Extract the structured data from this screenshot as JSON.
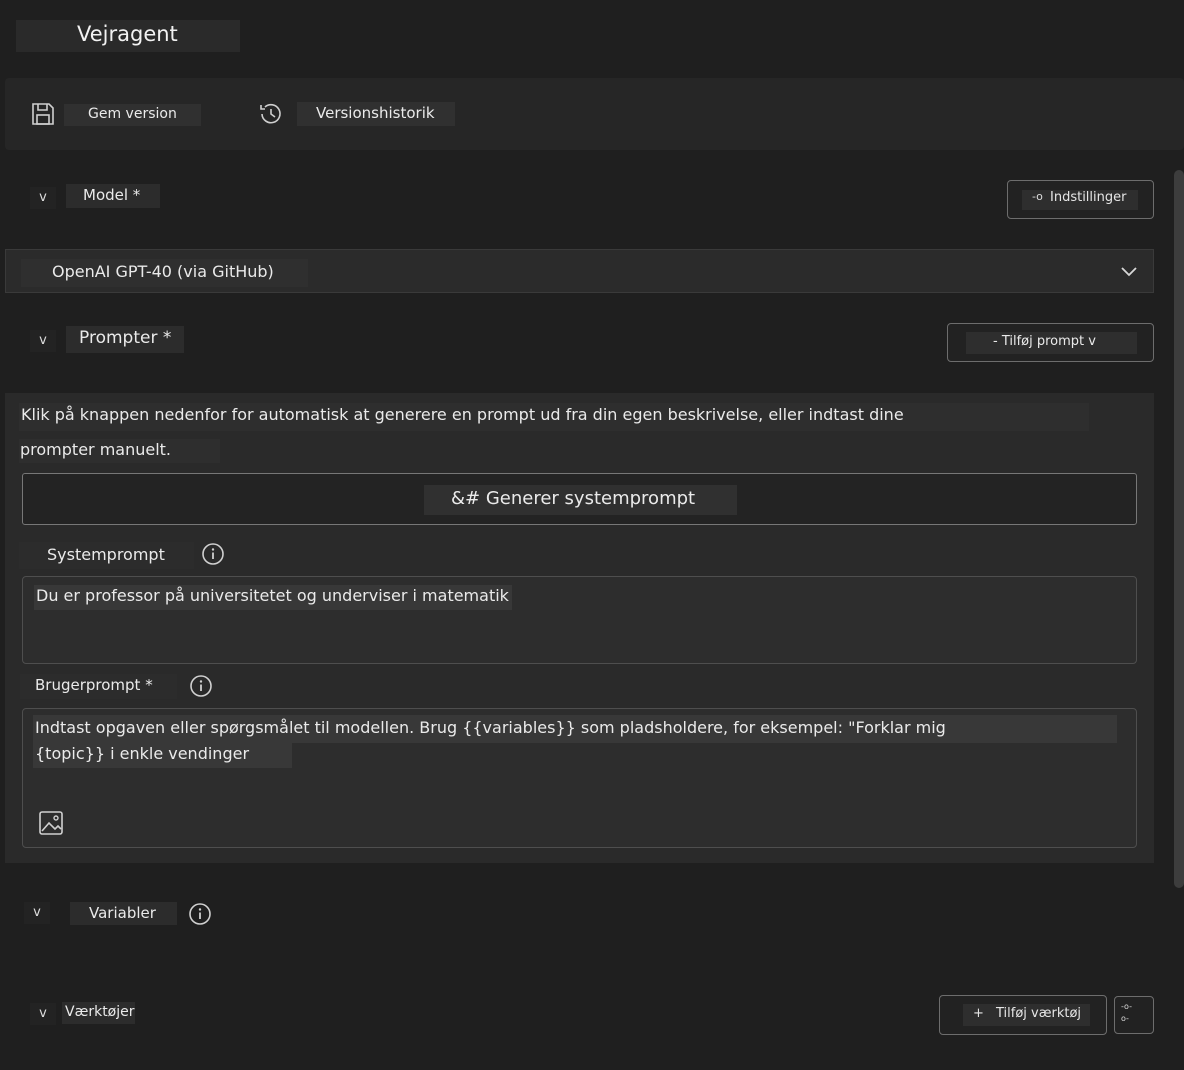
{
  "app": {
    "title": "Vejragent"
  },
  "toolbar": {
    "save_label": "Gem version",
    "history_label": "Versionshistorik",
    "save_icon": "save-icon",
    "history_icon": "history-icon"
  },
  "model_section": {
    "chevron": "v",
    "label": "Model *",
    "settings_label": "Indstillinger",
    "settings_icon_text": "-o",
    "selected_model": "OpenAI GPT-40 (via GitHub)"
  },
  "prompts_section": {
    "chevron": "v",
    "label": "Prompter *",
    "add_prompt_label": "- Tilføj prompt v",
    "instruction_line1": "Klik på knappen nedenfor for automatisk at generere en prompt ud fra din egen beskrivelse, eller indtast dine",
    "instruction_line2": "prompter manuelt.",
    "generate_label": "&# Generer systemprompt",
    "system_prompt_label": "Systemprompt",
    "system_prompt_value": "Du er professor på universitetet og underviser i matematik",
    "user_prompt_label": "Brugerprompt *",
    "user_prompt_line1": "Indtast opgaven eller spørgsmålet til modellen. Brug {{variables}} som pladsholdere, for eksempel: \"Forklar mig",
    "user_prompt_line2": "{topic}} i enkle vendinger"
  },
  "variables_section": {
    "chevron": "v",
    "label": "Variabler"
  },
  "tools_section": {
    "chevron": "v",
    "label": "Værktøjer",
    "add_tool_plus": "+",
    "add_tool_label": "Tilføj værktøj",
    "tool_settings_line1": "-o-",
    "tool_settings_line2": "o-"
  },
  "colors": {
    "background": "#1f1f1f",
    "panel": "#2a2a2a",
    "border": "#6d6d6d"
  }
}
